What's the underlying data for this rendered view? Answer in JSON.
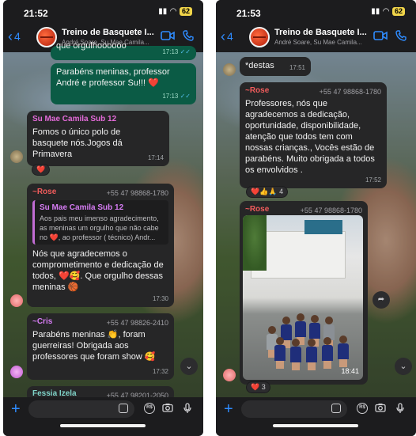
{
  "left": {
    "status_time": "21:52",
    "battery": "62",
    "header": {
      "back_count": "4",
      "title": "Treino de Basquete I...",
      "subtitle": "André Soare, Su Mae Camila..."
    },
    "msg_top_out": {
      "text": "que orgulhoooooo",
      "time": "17:13"
    },
    "msg_parabens": {
      "text": "Parabéns meninas, professor André e professor Su!!! ❤️",
      "time": "17:13"
    },
    "msg_sumae": {
      "sender": "Su Mae Camila Sub 12",
      "text": "Fomos o único polo de basquete nós.Jogos dá Primavera",
      "time": "17:14"
    },
    "reaction_sumae": "❤️",
    "msg_rose": {
      "sender": "~Rose",
      "phone": "+55 47 98868-1780",
      "quote_sender": "Su Mae Camila Sub 12",
      "quote_text": "Aos pais meu imenso agradecimento, as meninas um orgulho que não cabe no ❤️, ao professor ( técnico) Andr...",
      "text": "Nós que agradecemos o comprometimento e dedicação de todos, ❤️🥰. Que orgulho dessas meninas 🏀",
      "time": "17:30"
    },
    "msg_cris": {
      "sender": "~Cris",
      "phone": "+55 47 98826-2410",
      "text": "Parabéns meninas 👏, foram guerreiras! Obrigada aos professores que foram show 🥰",
      "time": "17:32"
    },
    "msg_partial": {
      "sender": "Fessia Izela",
      "phone": "+55 47 98201-2050"
    },
    "composer_placeholder": ""
  },
  "right": {
    "status_time": "21:53",
    "battery": "62",
    "header": {
      "back_count": "4",
      "title": "Treino de Basquete I...",
      "subtitle": "André Soare, Su Mae Camila..."
    },
    "msg_destas": {
      "text": "*destas",
      "time": "17:51"
    },
    "msg_rose_thanks": {
      "sender": "~Rose",
      "phone": "+55 47 98868-1780",
      "text": "Professores, nós que agradecemos a dedicação, oportunidade, disponibilidade, atenção que todos tem com nossas crianças., Vocês estão de parabéns. Muito obrigada a todos os envolvidos .",
      "time": "17:52"
    },
    "reaction_thanks": "❤️👍🙏 4",
    "msg_rose_photo": {
      "sender": "~Rose",
      "phone": "+55 47 98868-1780",
      "time": "18:41"
    },
    "reaction_photo": "❤️ 3",
    "composer_placeholder": ""
  },
  "icons": {
    "back": "chevron-left-icon",
    "video": "video-camera-icon",
    "call": "phone-icon",
    "plus": "plus-icon",
    "sticker": "sticker-icon",
    "payment": "rs-payment-icon",
    "camera": "camera-icon",
    "mic": "microphone-icon",
    "scroll": "chevron-down-icon",
    "forward": "forward-icon"
  },
  "colors": {
    "accent": "#2f8cff",
    "outgoing_bubble": "#0b5b45",
    "incoming_bubble": "#262627",
    "read_ticks": "#53bdeb"
  }
}
